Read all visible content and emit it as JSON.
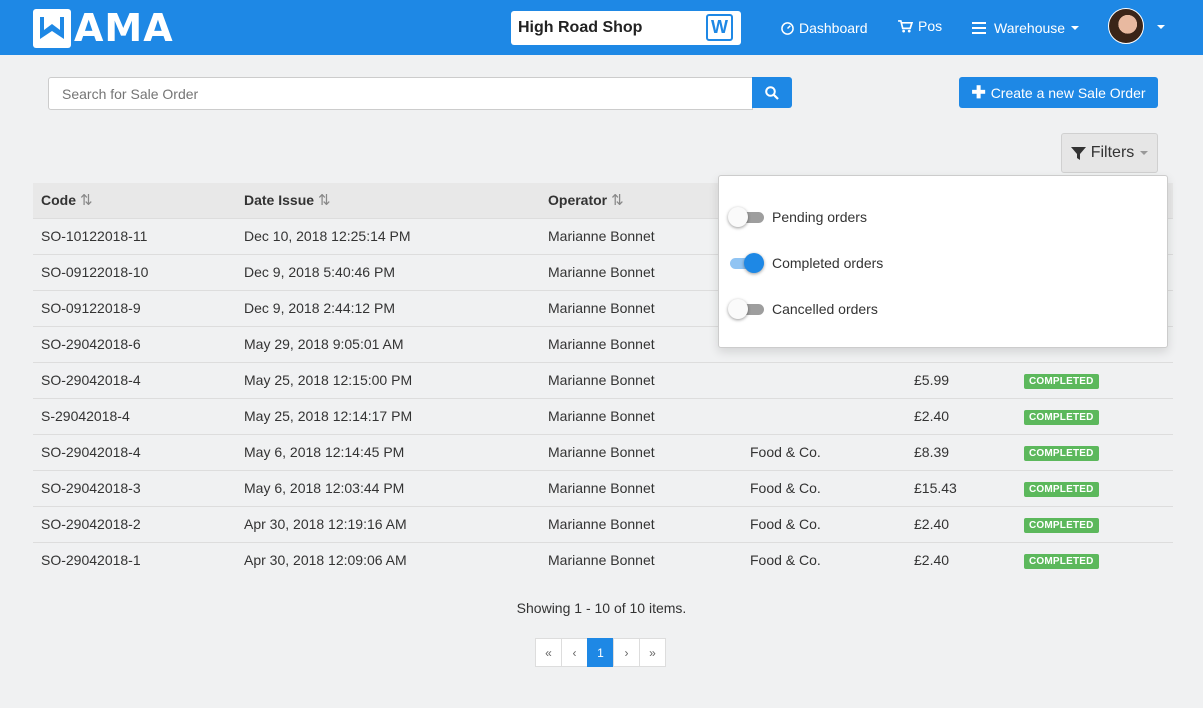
{
  "nav": {
    "logo_text": "AMA",
    "logo_letter": "W",
    "shop_name": "High Road Shop",
    "dashboard": "Dashboard",
    "pos": "Pos",
    "warehouse": "Warehouse",
    "brand_color": "#1e88e5"
  },
  "toolbar": {
    "search_placeholder": "Search for Sale Order",
    "create_label": "Create a new Sale Order",
    "filters_label": "Filters"
  },
  "table": {
    "headers": [
      "Code",
      "Date Issue",
      "Operator"
    ],
    "rows": [
      {
        "code": "SO-10122018-11",
        "date": "Dec 10, 2018 12:25:14 PM",
        "operator": "Marianne Bonnet",
        "customer": "",
        "amount": "",
        "status": ""
      },
      {
        "code": "SO-09122018-10",
        "date": "Dec 9, 2018 5:40:46 PM",
        "operator": "Marianne Bonnet",
        "customer": "",
        "amount": "",
        "status": ""
      },
      {
        "code": "SO-09122018-9",
        "date": "Dec 9, 2018 2:44:12 PM",
        "operator": "Marianne Bonnet",
        "customer": "",
        "amount": "",
        "status": ""
      },
      {
        "code": "SO-29042018-6",
        "date": "May 29, 2018 9:05:01 AM",
        "operator": "Marianne Bonnet",
        "customer": "",
        "amount": "",
        "status": ""
      },
      {
        "code": "SO-29042018-4",
        "date": "May 25, 2018 12:15:00 PM",
        "operator": "Marianne Bonnet",
        "customer": "",
        "amount": "£5.99",
        "status": "COMPLETED"
      },
      {
        "code": "S-29042018-4",
        "date": "May 25, 2018 12:14:17 PM",
        "operator": "Marianne Bonnet",
        "customer": "",
        "amount": "£2.40",
        "status": "COMPLETED"
      },
      {
        "code": "SO-29042018-4",
        "date": "May 6, 2018 12:14:45 PM",
        "operator": "Marianne Bonnet",
        "customer": "Food & Co.",
        "amount": "£8.39",
        "status": "COMPLETED"
      },
      {
        "code": "SO-29042018-3",
        "date": "May 6, 2018 12:03:44 PM",
        "operator": "Marianne Bonnet",
        "customer": "Food & Co.",
        "amount": "£15.43",
        "status": "COMPLETED"
      },
      {
        "code": "SO-29042018-2",
        "date": "Apr 30, 2018 12:19:16 AM",
        "operator": "Marianne Bonnet",
        "customer": "Food & Co.",
        "amount": "£2.40",
        "status": "COMPLETED"
      },
      {
        "code": "SO-29042018-1",
        "date": "Apr 30, 2018 12:09:06 AM",
        "operator": "Marianne Bonnet",
        "customer": "Food & Co.",
        "amount": "£2.40",
        "status": "COMPLETED"
      }
    ]
  },
  "filters": {
    "items": [
      {
        "label": "Pending orders",
        "on": false
      },
      {
        "label": "Completed orders",
        "on": true
      },
      {
        "label": "Cancelled orders",
        "on": false
      }
    ]
  },
  "pagination": {
    "summary": "Showing 1 - 10 of 10 items.",
    "first": "«",
    "prev": "‹",
    "current": "1",
    "next": "›",
    "last": "»"
  }
}
